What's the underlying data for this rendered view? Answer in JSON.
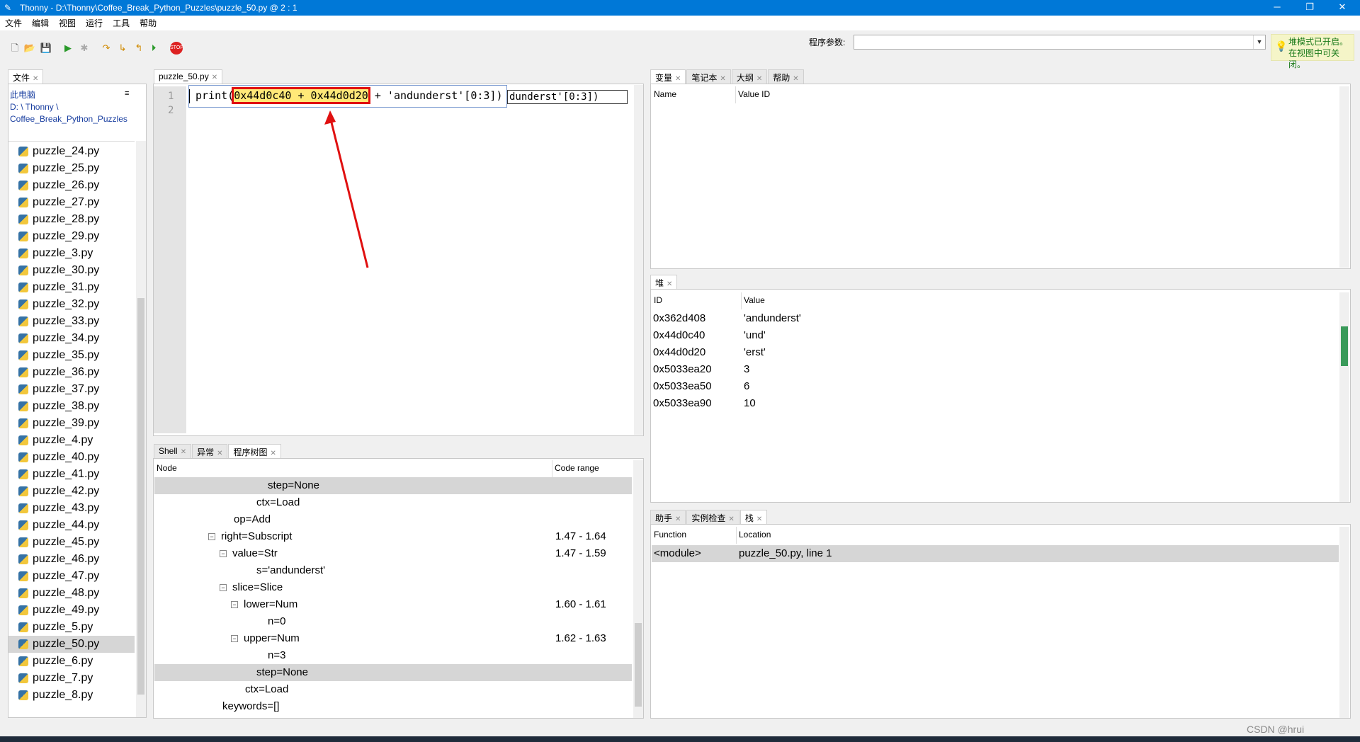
{
  "window": {
    "title": "Thonny  -  D:\\Thonny\\Coffee_Break_Python_Puzzles\\puzzle_50.py  @  2 : 1"
  },
  "menu": [
    "文件",
    "编辑",
    "视图",
    "运行",
    "工具",
    "帮助"
  ],
  "toolbar": {
    "args_label": "程序参数:",
    "args_value": "",
    "notice": "堆模式已开启。在视图中可关闭。",
    "icons": [
      "new-file-icon",
      "open-file-icon",
      "save-icon",
      "run-icon",
      "debug-icon",
      "step-over-icon",
      "step-into-icon",
      "step-out-icon",
      "resume-icon",
      "stop-icon"
    ]
  },
  "files": {
    "tab": "文件",
    "path_label": "此电脑",
    "path": "D: \\ Thonny \\ Coffee_Break_Python_Puzzles",
    "items": [
      "puzzle_24.py",
      "puzzle_25.py",
      "puzzle_26.py",
      "puzzle_27.py",
      "puzzle_28.py",
      "puzzle_29.py",
      "puzzle_3.py",
      "puzzle_30.py",
      "puzzle_31.py",
      "puzzle_32.py",
      "puzzle_33.py",
      "puzzle_34.py",
      "puzzle_35.py",
      "puzzle_36.py",
      "puzzle_37.py",
      "puzzle_38.py",
      "puzzle_39.py",
      "puzzle_4.py",
      "puzzle_40.py",
      "puzzle_41.py",
      "puzzle_42.py",
      "puzzle_43.py",
      "puzzle_44.py",
      "puzzle_45.py",
      "puzzle_46.py",
      "puzzle_47.py",
      "puzzle_48.py",
      "puzzle_49.py",
      "puzzle_5.py",
      "puzzle_50.py",
      "puzzle_6.py",
      "puzzle_7.py",
      "puzzle_8.py"
    ],
    "selected": "puzzle_50.py"
  },
  "editor": {
    "tab": "puzzle_50.py",
    "line_numbers": [
      "1",
      "2"
    ],
    "code_tail": "dunderst'[0:3])",
    "tooltip_prefix": "print(",
    "tooltip_highlight": "0x44d0c40 + 0x44d0d20",
    "tooltip_suffix": " + 'andunderst'[0:3])"
  },
  "bottom_tabs": [
    "Shell",
    "异常",
    "程序树图"
  ],
  "tree": {
    "col_node": "Node",
    "col_range": "Code range",
    "rows": [
      {
        "text": "step=None",
        "range": "",
        "indent": 160,
        "toggle": false,
        "selected": true
      },
      {
        "text": "ctx=Load",
        "range": "",
        "indent": 144,
        "toggle": false,
        "selected": false
      },
      {
        "text": "op=Add",
        "range": "",
        "indent": 112,
        "toggle": false,
        "selected": false
      },
      {
        "text": "right=Subscript",
        "range": "1.47  -  1.64",
        "indent": 96,
        "toggle": true,
        "selected": false
      },
      {
        "text": "value=Str",
        "range": "1.47  -  1.59",
        "indent": 112,
        "toggle": true,
        "selected": false
      },
      {
        "text": "s='andunderst'",
        "range": "",
        "indent": 144,
        "toggle": false,
        "selected": false
      },
      {
        "text": "slice=Slice",
        "range": "",
        "indent": 112,
        "toggle": true,
        "selected": false
      },
      {
        "text": "lower=Num",
        "range": "1.60  -  1.61",
        "indent": 128,
        "toggle": true,
        "selected": false
      },
      {
        "text": "n=0",
        "range": "",
        "indent": 160,
        "toggle": false,
        "selected": false
      },
      {
        "text": "upper=Num",
        "range": "1.62  -  1.63",
        "indent": 128,
        "toggle": true,
        "selected": false
      },
      {
        "text": "n=3",
        "range": "",
        "indent": 160,
        "toggle": false,
        "selected": false
      },
      {
        "text": "step=None",
        "range": "",
        "indent": 144,
        "toggle": false,
        "selected": true
      },
      {
        "text": "ctx=Load",
        "range": "",
        "indent": 128,
        "toggle": false,
        "selected": false
      },
      {
        "text": "keywords=[]",
        "range": "",
        "indent": 96,
        "toggle": false,
        "selected": false
      }
    ]
  },
  "variables": {
    "tabs": [
      "变量",
      "笔记本",
      "大纲",
      "帮助"
    ],
    "col_name": "Name",
    "col_value": "Value ID"
  },
  "heap": {
    "tab": "堆",
    "col_id": "ID",
    "col_value": "Value",
    "rows": [
      {
        "id": "0x362d408",
        "value": "'andunderst'"
      },
      {
        "id": "0x44d0c40",
        "value": "'und'"
      },
      {
        "id": "0x44d0d20",
        "value": "'erst'"
      },
      {
        "id": "0x5033ea20",
        "value": "3"
      },
      {
        "id": "0x5033ea50",
        "value": "6"
      },
      {
        "id": "0x5033ea90",
        "value": "10"
      }
    ]
  },
  "stack": {
    "tabs": [
      "助手",
      "实例检查",
      "栈"
    ],
    "col_function": "Function",
    "col_location": "Location",
    "rows": [
      {
        "function": "<module>",
        "location": "puzzle_50.py, line 1"
      }
    ]
  },
  "watermark": "CSDN @hrui"
}
